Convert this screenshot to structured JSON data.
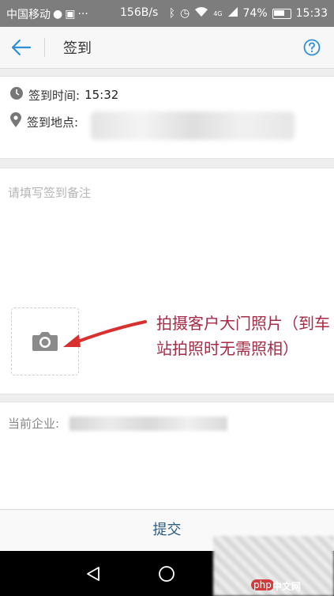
{
  "status_bar": {
    "carrier": "中国移动",
    "speed": "156B/s",
    "signal_label": "4G",
    "battery": "74%",
    "time": "15:33"
  },
  "header": {
    "title": "签到"
  },
  "checkin": {
    "time_label": "签到时间:",
    "time_value": "15:32",
    "location_label": "签到地点:"
  },
  "remark": {
    "placeholder": "请填写签到备注"
  },
  "annotation": {
    "text": "拍摄客户大门照片（到车站拍照时无需照相）"
  },
  "company": {
    "label": "当前企业:"
  },
  "submit": {
    "label": "提交"
  },
  "watermark": {
    "logo": "php",
    "text": "中文网"
  },
  "colors": {
    "accent": "#2f8fd6",
    "submit_text": "#2b5d84",
    "annotation": "#a52a45",
    "arrow": "#d9302e"
  }
}
